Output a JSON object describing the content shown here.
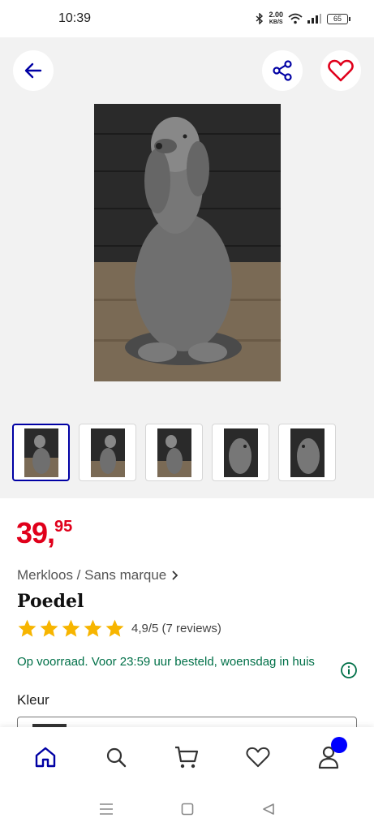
{
  "status": {
    "time": "10:39",
    "net_speed_top": "2.00",
    "net_speed_bottom": "KB/S",
    "battery": "65"
  },
  "gallery": {
    "thumbnail_count": 5,
    "active_thumbnail": 0
  },
  "product": {
    "price_int": "39,",
    "price_dec": "95",
    "brand": "Merkloos / Sans marque",
    "title": "Poedel",
    "rating_text": "4,9/5 (7 reviews)",
    "rating_value": 4.9,
    "stock_text": "Op voorraad. Voor 23:59 uur besteld, woensdag in huis",
    "color_label": "Kleur"
  },
  "colors": {
    "price": "#e0001b",
    "accent": "#0000a4",
    "stock": "#007048",
    "star": "#f7b500",
    "badge": "#0000ff"
  },
  "icons": {
    "back": "arrow-left-icon",
    "share": "share-icon",
    "favorite": "heart-icon",
    "info": "info-icon",
    "nav": [
      "home-icon",
      "search-icon",
      "cart-icon",
      "heart-icon",
      "user-icon"
    ]
  }
}
